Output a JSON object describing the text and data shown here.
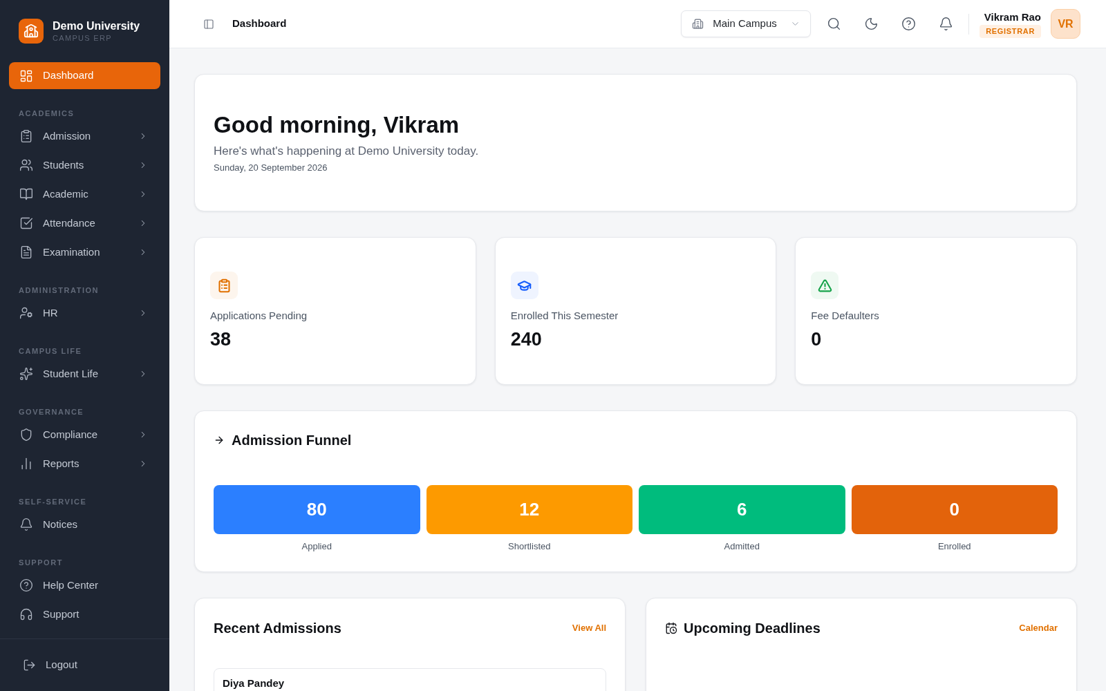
{
  "sidebar": {
    "brand": {
      "name": "Demo University",
      "subtitle": "CAMPUS ERP"
    },
    "sections": [
      {
        "items": [
          {
            "label": "Dashboard",
            "selected": true,
            "expandable": false
          }
        ]
      },
      {
        "heading": "ACADEMICS",
        "items": [
          {
            "label": "Admission",
            "selected": false,
            "expandable": true
          },
          {
            "label": "Students",
            "selected": false,
            "expandable": true
          },
          {
            "label": "Academic",
            "selected": false,
            "expandable": true
          },
          {
            "label": "Attendance",
            "selected": false,
            "expandable": true
          },
          {
            "label": "Examination",
            "selected": false,
            "expandable": true
          }
        ]
      },
      {
        "heading": "ADMINISTRATION",
        "items": [
          {
            "label": "HR",
            "selected": false,
            "expandable": true
          }
        ]
      },
      {
        "heading": "CAMPUS LIFE",
        "items": [
          {
            "label": "Student Life",
            "selected": false,
            "expandable": true
          }
        ]
      },
      {
        "heading": "GOVERNANCE",
        "items": [
          {
            "label": "Compliance",
            "selected": false,
            "expandable": true
          },
          {
            "label": "Reports",
            "selected": false,
            "expandable": true
          }
        ]
      },
      {
        "heading": "SELF-SERVICE",
        "items": [
          {
            "label": "Notices",
            "selected": false,
            "expandable": false
          }
        ]
      },
      {
        "heading": "SUPPORT",
        "items": [
          {
            "label": "Help Center",
            "selected": false,
            "expandable": false
          },
          {
            "label": "Support",
            "selected": false,
            "expandable": false
          }
        ]
      }
    ],
    "logout": {
      "label": "Logout"
    }
  },
  "header": {
    "page_title": "Dashboard",
    "campus_select": {
      "value": "Main Campus"
    },
    "user": {
      "name": "Vikram Rao",
      "role": "REGISTRAR",
      "initials": "VR"
    }
  },
  "welcome": {
    "title": "Good morning, Vikram",
    "subtitle": "Here's what's happening at Demo University today.",
    "date": "Sunday, 20 September 2026"
  },
  "stats": [
    {
      "label": "Applications Pending",
      "value": "38",
      "color": "#e17100"
    },
    {
      "label": "Enrolled This Semester",
      "value": "240",
      "color": "#155dfc"
    },
    {
      "label": "Fee Defaulters",
      "value": "0",
      "color": "#16a34a"
    }
  ],
  "funnel": {
    "title": "Admission Funnel",
    "stages": [
      {
        "value": "80",
        "label": "Applied",
        "color": "#2b7fff"
      },
      {
        "value": "12",
        "label": "Shortlisted",
        "color": "#fd9a00"
      },
      {
        "value": "6",
        "label": "Admitted",
        "color": "#00bc7d"
      },
      {
        "value": "0",
        "label": "Enrolled",
        "color": "#e3630b"
      }
    ]
  },
  "recent_admissions": {
    "title": "Recent Admissions",
    "link": "View All",
    "items": [
      {
        "name": "Diya Pandey"
      }
    ]
  },
  "upcoming_deadlines": {
    "title": "Upcoming Deadlines",
    "link": "Calendar"
  }
}
